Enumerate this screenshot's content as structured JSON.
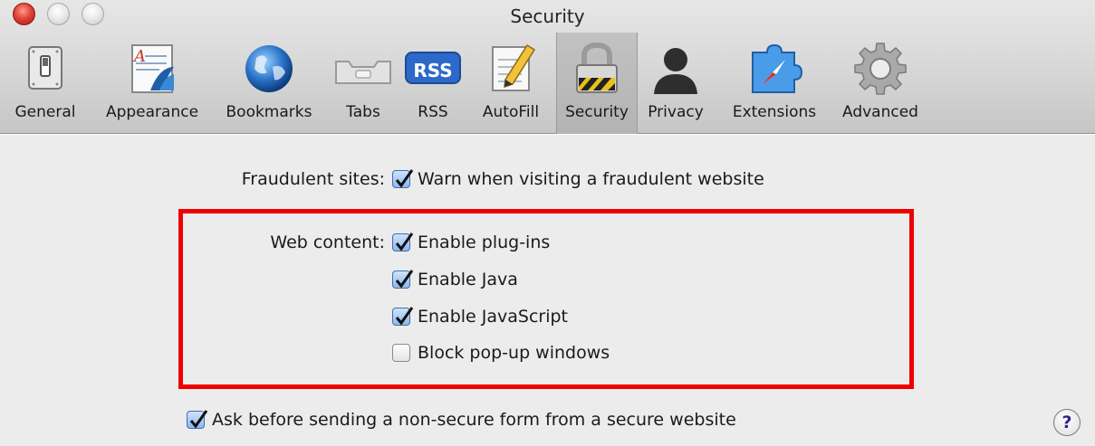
{
  "window": {
    "title": "Security"
  },
  "toolbar": {
    "items": [
      {
        "label": "General",
        "icon": "switch-icon"
      },
      {
        "label": "Appearance",
        "icon": "appearance-icon"
      },
      {
        "label": "Bookmarks",
        "icon": "globe-icon"
      },
      {
        "label": "Tabs",
        "icon": "tabs-icon"
      },
      {
        "label": "RSS",
        "icon": "rss-icon"
      },
      {
        "label": "AutoFill",
        "icon": "autofill-pencil-icon"
      },
      {
        "label": "Security",
        "icon": "padlock-icon",
        "selected": true
      },
      {
        "label": "Privacy",
        "icon": "person-silhouette-icon"
      },
      {
        "label": "Extensions",
        "icon": "puzzle-compass-icon"
      },
      {
        "label": "Advanced",
        "icon": "gear-icon"
      }
    ],
    "rss_badge": "RSS"
  },
  "security": {
    "fraudulent": {
      "label": "Fraudulent sites:",
      "option": {
        "text": "Warn when visiting a fraudulent website",
        "checked": true
      }
    },
    "web_content": {
      "label": "Web content:",
      "options": [
        {
          "text": "Enable plug-ins",
          "checked": true
        },
        {
          "text": "Enable Java",
          "checked": true
        },
        {
          "text": "Enable JavaScript",
          "checked": true
        },
        {
          "text": "Block pop-up windows",
          "checked": false
        }
      ]
    },
    "nonsecure_form": {
      "text": "Ask before sending a non-secure form from a secure website",
      "checked": true
    },
    "help_label": "?"
  },
  "colors": {
    "highlight": "#ee0000",
    "checkbox_checked": "#8db8ec",
    "window_background": "#ececec"
  }
}
